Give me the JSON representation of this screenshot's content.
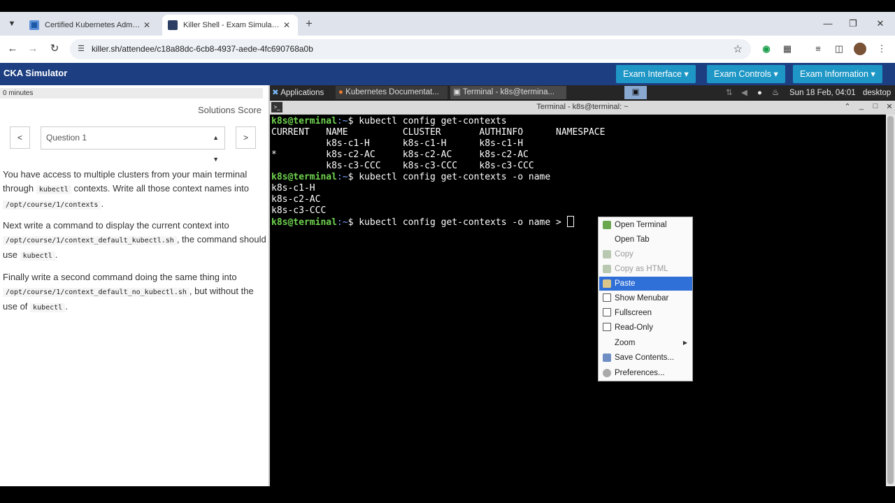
{
  "browser": {
    "tabs": [
      {
        "label": "Certified Kubernetes Administra",
        "active": false
      },
      {
        "label": "Killer Shell - Exam Simulators",
        "active": true
      }
    ],
    "url": "killer.sh/attendee/c18a88dc-6cb8-4937-aede-4fc690768a0b"
  },
  "app": {
    "title": "CKA Simulator",
    "header_buttons": [
      "Exam Interface",
      "Exam Controls",
      "Exam Information"
    ]
  },
  "left": {
    "timer": "0 minutes",
    "solutions_score": "Solutions Score",
    "prev_label": "<",
    "next_label": ">",
    "question_select": "Question 1",
    "question": {
      "p1a": "You have access to multiple clusters from your main terminal through",
      "p1code1": "kubectl",
      "p1b": "contexts. Write all those context names into",
      "p1code2": "/opt/course/1/contexts",
      "p1c": ".",
      "p2a": "Next write a command to display the current context into",
      "p2code1": "/opt/course/1/context_default_kubectl.sh",
      "p2b": ", the command should use",
      "p2code2": "kubectl",
      "p2c": ".",
      "p3a": "Finally write a second command doing the same thing into",
      "p3code1": "/opt/course/1/context_default_no_kubectl.sh",
      "p3b": ", but without the use of",
      "p3code2": "kubectl",
      "p3c": "."
    }
  },
  "desktop_panel": {
    "applications": "Applications",
    "task1": "Kubernetes Documentat...",
    "task2": "Terminal - k8s@termina...",
    "datetime": "Sun 18 Feb, 04:01",
    "desktop": "desktop"
  },
  "terminal": {
    "title": "Terminal - k8s@terminal: ~",
    "prompt_user": "k8s@terminal",
    "prompt_path": ":~",
    "prompt_sign": "$ ",
    "cmd1": "kubectl config get-contexts",
    "table": [
      "CURRENT   NAME          CLUSTER       AUTHINFO      NAMESPACE",
      "          k8s-c1-H      k8s-c1-H      k8s-c1-H",
      "*         k8s-c2-AC     k8s-c2-AC     k8s-c2-AC",
      "          k8s-c3-CCC    k8s-c3-CCC    k8s-c3-CCC"
    ],
    "cmd2": "kubectl config get-contexts -o name",
    "out2": [
      "k8s-c1-H",
      "k8s-c2-AC",
      "k8s-c3-CCC"
    ],
    "cmd3": "kubectl config get-contexts -o name > "
  },
  "context_menu": {
    "open_terminal": "Open Terminal",
    "open_tab": "Open Tab",
    "copy": "Copy",
    "copy_html": "Copy as HTML",
    "paste": "Paste",
    "show_menubar": "Show Menubar",
    "fullscreen": "Fullscreen",
    "read_only": "Read-Only",
    "zoom": "Zoom",
    "save_contents": "Save Contents...",
    "preferences": "Preferences..."
  },
  "colors": {
    "app_header": "#1d3f82",
    "header_button": "#1f97c6",
    "prompt_green": "#6fd34f",
    "menu_highlight": "#2f6fd8"
  }
}
